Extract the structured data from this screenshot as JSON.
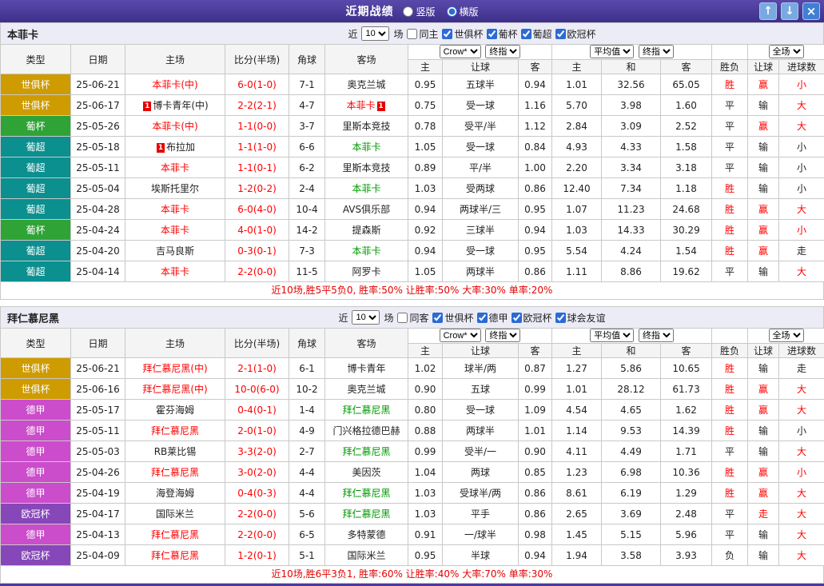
{
  "topbar": {
    "title": "近期战绩",
    "layout_options": [
      {
        "label": "竖版",
        "selected": false
      },
      {
        "label": "横版",
        "selected": true
      }
    ],
    "up_icon": "↑",
    "down_icon": "↓",
    "close_icon": "×"
  },
  "labels": {
    "near": "近",
    "games": "场"
  },
  "header": {
    "col_type": "类型",
    "col_date": "日期",
    "col_home": "主场",
    "col_score": "比分(半场)",
    "col_corner": "角球",
    "col_away": "客场",
    "asia_select": "Crow*",
    "asia_index_select": "终指",
    "asia_cols": [
      "主",
      "让球",
      "客"
    ],
    "europe_select": "平均值",
    "europe_index_select": "终指",
    "europe_cols": [
      "主",
      "和",
      "客"
    ],
    "col_winloss": "胜负",
    "full_select": "全场",
    "full_cols": [
      "让球",
      "进球数"
    ]
  },
  "sections": [
    {
      "team": "本菲卡",
      "near_value": "10",
      "same_side_label": "同主",
      "same_side_checked": false,
      "leagues": [
        "世俱杯",
        "葡杯",
        "葡超",
        "欧冠杯"
      ],
      "summary": "近10场,胜5平5负0, 胜率:50% 让胜率:50% 大率:30% 单率:20%",
      "rows": [
        {
          "league": "世俱杯",
          "league_color": "#ce9b00",
          "date": "25-06-21",
          "home": "本菲卡(中)",
          "home_color": "#ff0000",
          "home_badge": "",
          "score": "6-0(1-0)",
          "corner": "7-1",
          "away": "奥克兰城",
          "away_color": "#222222",
          "away_badge": "",
          "asia": [
            "0.95",
            "五球半",
            "0.94"
          ],
          "europe": [
            "1.01",
            "32.56",
            "65.05"
          ],
          "results": [
            [
              "胜",
              "#ff0000"
            ],
            [
              "赢",
              "#ff0000"
            ],
            [
              "小",
              "#ff0000"
            ]
          ]
        },
        {
          "league": "世俱杯",
          "league_color": "#ce9b00",
          "date": "25-06-17",
          "home": "博卡青年(中)",
          "home_color": "#222222",
          "home_badge": "1",
          "score": "2-2(2-1)",
          "corner": "4-7",
          "away": "本菲卡",
          "away_color": "#ff0000",
          "away_badge": "1",
          "asia": [
            "0.75",
            "受一球",
            "1.16"
          ],
          "europe": [
            "5.70",
            "3.98",
            "1.60"
          ],
          "results": [
            [
              "平",
              "#222222"
            ],
            [
              "输",
              "#222222"
            ],
            [
              "大",
              "#ff0000"
            ]
          ]
        },
        {
          "league": "葡杯",
          "league_color": "#2fa336",
          "date": "25-05-26",
          "home": "本菲卡(中)",
          "home_color": "#ff0000",
          "home_badge": "",
          "score": "1-1(0-0)",
          "corner": "3-7",
          "away": "里斯本竞技",
          "away_color": "#222222",
          "away_badge": "",
          "asia": [
            "0.78",
            "受平/半",
            "1.12"
          ],
          "europe": [
            "2.84",
            "3.09",
            "2.52"
          ],
          "results": [
            [
              "平",
              "#222222"
            ],
            [
              "赢",
              "#ff0000"
            ],
            [
              "大",
              "#ff0000"
            ]
          ]
        },
        {
          "league": "葡超",
          "league_color": "#0b8f8f",
          "date": "25-05-18",
          "home": "布拉加",
          "home_color": "#222222",
          "home_badge": "1",
          "score": "1-1(1-0)",
          "corner": "6-6",
          "away": "本菲卡",
          "away_color": "#009900",
          "away_badge": "",
          "asia": [
            "1.05",
            "受一球",
            "0.84"
          ],
          "europe": [
            "4.93",
            "4.33",
            "1.58"
          ],
          "results": [
            [
              "平",
              "#222222"
            ],
            [
              "输",
              "#222222"
            ],
            [
              "小",
              "#222222"
            ]
          ]
        },
        {
          "league": "葡超",
          "league_color": "#0b8f8f",
          "date": "25-05-11",
          "home": "本菲卡",
          "home_color": "#ff0000",
          "home_badge": "",
          "score": "1-1(0-1)",
          "corner": "6-2",
          "away": "里斯本竞技",
          "away_color": "#222222",
          "away_badge": "",
          "asia": [
            "0.89",
            "平/半",
            "1.00"
          ],
          "europe": [
            "2.20",
            "3.34",
            "3.18"
          ],
          "results": [
            [
              "平",
              "#222222"
            ],
            [
              "输",
              "#222222"
            ],
            [
              "小",
              "#222222"
            ]
          ]
        },
        {
          "league": "葡超",
          "league_color": "#0b8f8f",
          "date": "25-05-04",
          "home": "埃斯托里尔",
          "home_color": "#222222",
          "home_badge": "",
          "score": "1-2(0-2)",
          "corner": "2-4",
          "away": "本菲卡",
          "away_color": "#009900",
          "away_badge": "",
          "asia": [
            "1.03",
            "受两球",
            "0.86"
          ],
          "europe": [
            "12.40",
            "7.34",
            "1.18"
          ],
          "results": [
            [
              "胜",
              "#ff0000"
            ],
            [
              "输",
              "#222222"
            ],
            [
              "小",
              "#222222"
            ]
          ]
        },
        {
          "league": "葡超",
          "league_color": "#0b8f8f",
          "date": "25-04-28",
          "home": "本菲卡",
          "home_color": "#ff0000",
          "home_badge": "",
          "score": "6-0(4-0)",
          "corner": "10-4",
          "away": "AVS俱乐部",
          "away_color": "#222222",
          "away_badge": "",
          "asia": [
            "0.94",
            "两球半/三",
            "0.95"
          ],
          "europe": [
            "1.07",
            "11.23",
            "24.68"
          ],
          "results": [
            [
              "胜",
              "#ff0000"
            ],
            [
              "赢",
              "#ff0000"
            ],
            [
              "大",
              "#ff0000"
            ]
          ]
        },
        {
          "league": "葡杯",
          "league_color": "#2fa336",
          "date": "25-04-24",
          "home": "本菲卡",
          "home_color": "#ff0000",
          "home_badge": "",
          "score": "4-0(1-0)",
          "corner": "14-2",
          "away": "提森斯",
          "away_color": "#222222",
          "away_badge": "",
          "asia": [
            "0.92",
            "三球半",
            "0.94"
          ],
          "europe": [
            "1.03",
            "14.33",
            "30.29"
          ],
          "results": [
            [
              "胜",
              "#ff0000"
            ],
            [
              "赢",
              "#ff0000"
            ],
            [
              "小",
              "#ff0000"
            ]
          ]
        },
        {
          "league": "葡超",
          "league_color": "#0b8f8f",
          "date": "25-04-20",
          "home": "吉马良斯",
          "home_color": "#222222",
          "home_badge": "",
          "score": "0-3(0-1)",
          "corner": "7-3",
          "away": "本菲卡",
          "away_color": "#009900",
          "away_badge": "",
          "asia": [
            "0.94",
            "受一球",
            "0.95"
          ],
          "europe": [
            "5.54",
            "4.24",
            "1.54"
          ],
          "results": [
            [
              "胜",
              "#ff0000"
            ],
            [
              "赢",
              "#ff0000"
            ],
            [
              "走",
              "#222222"
            ]
          ]
        },
        {
          "league": "葡超",
          "league_color": "#0b8f8f",
          "date": "25-04-14",
          "home": "本菲卡",
          "home_color": "#ff0000",
          "home_badge": "",
          "score": "2-2(0-0)",
          "corner": "11-5",
          "away": "阿罗卡",
          "away_color": "#222222",
          "away_badge": "",
          "asia": [
            "1.05",
            "两球半",
            "0.86"
          ],
          "europe": [
            "1.11",
            "8.86",
            "19.62"
          ],
          "results": [
            [
              "平",
              "#222222"
            ],
            [
              "输",
              "#222222"
            ],
            [
              "大",
              "#ff0000"
            ]
          ]
        }
      ]
    },
    {
      "team": "拜仁慕尼黑",
      "near_value": "10",
      "same_side_label": "同客",
      "same_side_checked": false,
      "leagues": [
        "世俱杯",
        "德甲",
        "欧冠杯",
        "球会友谊"
      ],
      "summary": "近10场,胜6平3负1, 胜率:60% 让胜率:40% 大率:70% 单率:30%",
      "rows": [
        {
          "league": "世俱杯",
          "league_color": "#ce9b00",
          "date": "25-06-21",
          "home": "拜仁慕尼黑(中)",
          "home_color": "#ff0000",
          "home_badge": "",
          "score": "2-1(1-0)",
          "corner": "6-1",
          "away": "博卡青年",
          "away_color": "#222222",
          "away_badge": "",
          "asia": [
            "1.02",
            "球半/两",
            "0.87"
          ],
          "europe": [
            "1.27",
            "5.86",
            "10.65"
          ],
          "results": [
            [
              "胜",
              "#ff0000"
            ],
            [
              "输",
              "#222222"
            ],
            [
              "走",
              "#222222"
            ]
          ]
        },
        {
          "league": "世俱杯",
          "league_color": "#ce9b00",
          "date": "25-06-16",
          "home": "拜仁慕尼黑(中)",
          "home_color": "#ff0000",
          "home_badge": "",
          "score": "10-0(6-0)",
          "corner": "10-2",
          "away": "奥克兰城",
          "away_color": "#222222",
          "away_badge": "",
          "asia": [
            "0.90",
            "五球",
            "0.99"
          ],
          "europe": [
            "1.01",
            "28.12",
            "61.73"
          ],
          "results": [
            [
              "胜",
              "#ff0000"
            ],
            [
              "赢",
              "#ff0000"
            ],
            [
              "大",
              "#ff0000"
            ]
          ]
        },
        {
          "league": "德甲",
          "league_color": "#cb4dcb",
          "date": "25-05-17",
          "home": "霍芬海姆",
          "home_color": "#222222",
          "home_badge": "",
          "score": "0-4(0-1)",
          "corner": "1-4",
          "away": "拜仁慕尼黑",
          "away_color": "#009900",
          "away_badge": "",
          "asia": [
            "0.80",
            "受一球",
            "1.09"
          ],
          "europe": [
            "4.54",
            "4.65",
            "1.62"
          ],
          "results": [
            [
              "胜",
              "#ff0000"
            ],
            [
              "赢",
              "#ff0000"
            ],
            [
              "大",
              "#ff0000"
            ]
          ]
        },
        {
          "league": "德甲",
          "league_color": "#cb4dcb",
          "date": "25-05-11",
          "home": "拜仁慕尼黑",
          "home_color": "#ff0000",
          "home_badge": "",
          "score": "2-0(1-0)",
          "corner": "4-9",
          "away": "门兴格拉德巴赫",
          "away_color": "#222222",
          "away_badge": "",
          "asia": [
            "0.88",
            "两球半",
            "1.01"
          ],
          "europe": [
            "1.14",
            "9.53",
            "14.39"
          ],
          "results": [
            [
              "胜",
              "#ff0000"
            ],
            [
              "输",
              "#222222"
            ],
            [
              "小",
              "#222222"
            ]
          ]
        },
        {
          "league": "德甲",
          "league_color": "#cb4dcb",
          "date": "25-05-03",
          "home": "RB莱比锡",
          "home_color": "#222222",
          "home_badge": "",
          "score": "3-3(2-0)",
          "corner": "2-7",
          "away": "拜仁慕尼黑",
          "away_color": "#009900",
          "away_badge": "",
          "asia": [
            "0.99",
            "受半/一",
            "0.90"
          ],
          "europe": [
            "4.11",
            "4.49",
            "1.71"
          ],
          "results": [
            [
              "平",
              "#222222"
            ],
            [
              "输",
              "#222222"
            ],
            [
              "大",
              "#ff0000"
            ]
          ]
        },
        {
          "league": "德甲",
          "league_color": "#cb4dcb",
          "date": "25-04-26",
          "home": "拜仁慕尼黑",
          "home_color": "#ff0000",
          "home_badge": "",
          "score": "3-0(2-0)",
          "corner": "4-4",
          "away": "美因茨",
          "away_color": "#222222",
          "away_badge": "",
          "asia": [
            "1.04",
            "两球",
            "0.85"
          ],
          "europe": [
            "1.23",
            "6.98",
            "10.36"
          ],
          "results": [
            [
              "胜",
              "#ff0000"
            ],
            [
              "赢",
              "#ff0000"
            ],
            [
              "小",
              "#ff0000"
            ]
          ]
        },
        {
          "league": "德甲",
          "league_color": "#cb4dcb",
          "date": "25-04-19",
          "home": "海登海姆",
          "home_color": "#222222",
          "home_badge": "",
          "score": "0-4(0-3)",
          "corner": "4-4",
          "away": "拜仁慕尼黑",
          "away_color": "#009900",
          "away_badge": "",
          "asia": [
            "1.03",
            "受球半/两",
            "0.86"
          ],
          "europe": [
            "8.61",
            "6.19",
            "1.29"
          ],
          "results": [
            [
              "胜",
              "#ff0000"
            ],
            [
              "赢",
              "#ff0000"
            ],
            [
              "大",
              "#ff0000"
            ]
          ]
        },
        {
          "league": "欧冠杯",
          "league_color": "#8647b8",
          "date": "25-04-17",
          "home": "国际米兰",
          "home_color": "#222222",
          "home_badge": "",
          "score": "2-2(0-0)",
          "corner": "5-6",
          "away": "拜仁慕尼黑",
          "away_color": "#009900",
          "away_badge": "",
          "asia": [
            "1.03",
            "平手",
            "0.86"
          ],
          "europe": [
            "2.65",
            "3.69",
            "2.48"
          ],
          "results": [
            [
              "平",
              "#222222"
            ],
            [
              "走",
              "#ff0000"
            ],
            [
              "大",
              "#ff0000"
            ]
          ]
        },
        {
          "league": "德甲",
          "league_color": "#cb4dcb",
          "date": "25-04-13",
          "home": "拜仁慕尼黑",
          "home_color": "#ff0000",
          "home_badge": "",
          "score": "2-2(0-0)",
          "corner": "6-5",
          "away": "多特蒙德",
          "away_color": "#222222",
          "away_badge": "",
          "asia": [
            "0.91",
            "一/球半",
            "0.98"
          ],
          "europe": [
            "1.45",
            "5.15",
            "5.96"
          ],
          "results": [
            [
              "平",
              "#222222"
            ],
            [
              "输",
              "#222222"
            ],
            [
              "大",
              "#ff0000"
            ]
          ]
        },
        {
          "league": "欧冠杯",
          "league_color": "#8647b8",
          "date": "25-04-09",
          "home": "拜仁慕尼黑",
          "home_color": "#ff0000",
          "home_badge": "",
          "score": "1-2(0-1)",
          "corner": "5-1",
          "away": "国际米兰",
          "away_color": "#222222",
          "away_badge": "",
          "asia": [
            "0.95",
            "半球",
            "0.94"
          ],
          "europe": [
            "1.94",
            "3.58",
            "3.93"
          ],
          "results": [
            [
              "负",
              "#222222"
            ],
            [
              "输",
              "#222222"
            ],
            [
              "大",
              "#ff0000"
            ]
          ]
        }
      ]
    }
  ]
}
